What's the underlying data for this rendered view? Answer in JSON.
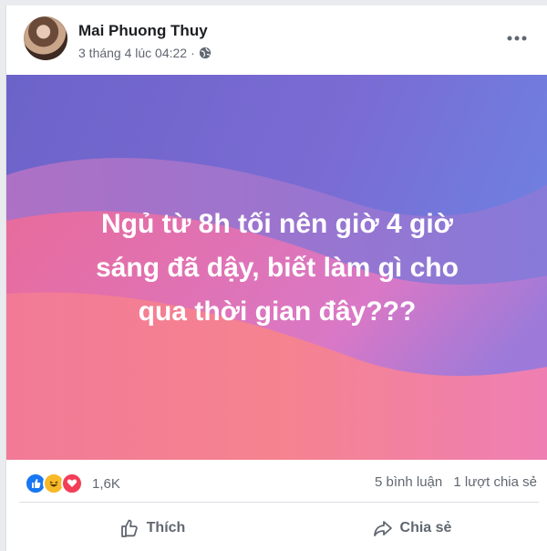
{
  "post": {
    "author": "Mai Phuong Thuy",
    "timestamp": "3 tháng 4 lúc 04:22",
    "separator": "·",
    "privacy_icon": "globe-icon",
    "more_icon": "more-options-icon",
    "text_lines": [
      "Ngủ từ 8h tối nên giờ 4 giờ",
      "sáng đã dậy, biết làm gì cho",
      "qua thời gian đây???"
    ],
    "background_colors": [
      "#5b6fd6",
      "#8a6fd8",
      "#e86a9a",
      "#f58b8f"
    ]
  },
  "stats": {
    "reaction_icons": [
      "like-icon",
      "haha-icon",
      "love-icon"
    ],
    "reaction_count": "1,6K",
    "comments": "5 bình luận",
    "shares": "1 lượt chia sẻ"
  },
  "actions": {
    "like_label": "Thích",
    "share_label": "Chia sẻ"
  },
  "colors": {
    "like_blue": "#1877f2",
    "haha_yellow": "#f7b928",
    "love_red": "#f33e58",
    "secondary_text": "#606770"
  }
}
